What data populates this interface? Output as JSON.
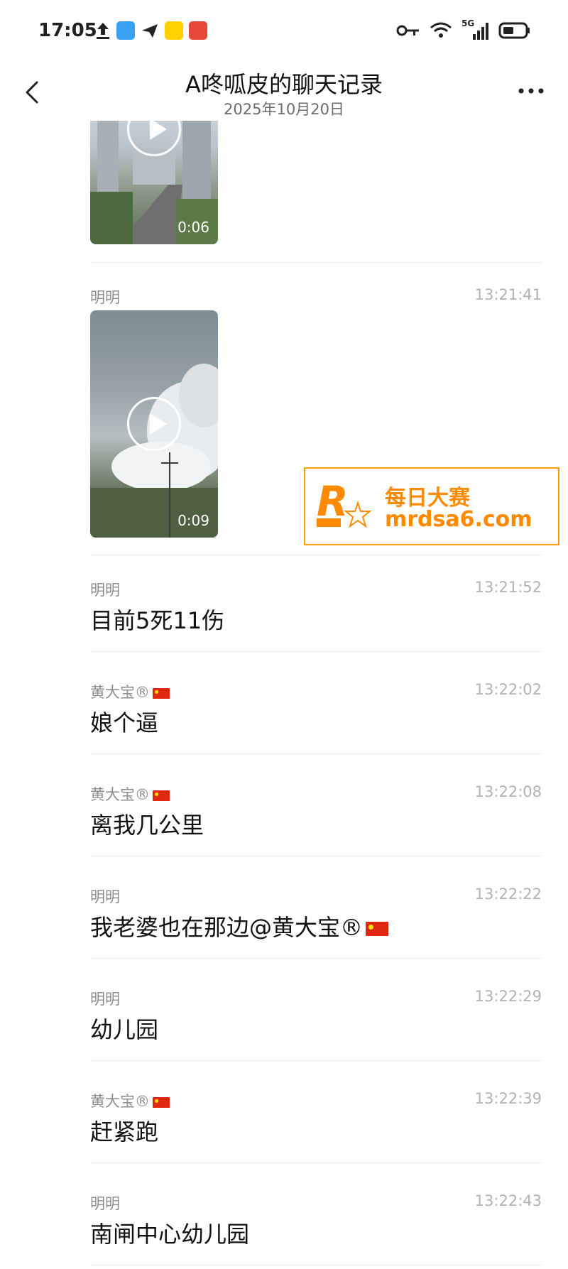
{
  "status_bar": {
    "time": "17:05",
    "network": "5G",
    "icons": [
      "upload-icon",
      "book-app-icon",
      "telegram-icon",
      "meituan-app-icon",
      "news-app-icon",
      "vpn-key-icon",
      "wifi-icon",
      "signal-icon",
      "battery-icon"
    ]
  },
  "header": {
    "title": "A咚呱皮的聊天记录",
    "date": "2025年10月20日"
  },
  "messages": [
    {
      "type": "video",
      "duration": "0:06"
    },
    {
      "type": "video",
      "sender": "明明",
      "time": "13:21:41",
      "duration": "0:09"
    },
    {
      "type": "text",
      "sender": "明明",
      "time": "13:21:52",
      "text": "目前5死11伤"
    },
    {
      "type": "text",
      "sender": "黄大宝®",
      "time": "13:22:02",
      "text": "娘个逼"
    },
    {
      "type": "text",
      "sender": "黄大宝®",
      "time": "13:22:08",
      "text": "离我几公里"
    },
    {
      "type": "text",
      "sender": "明明",
      "time": "13:22:22",
      "text": "我老婆也在那边@黄大宝®"
    },
    {
      "type": "text",
      "sender": "明明",
      "time": "13:22:29",
      "text": "幼儿园"
    },
    {
      "type": "text",
      "sender": "黄大宝®",
      "time": "13:22:39",
      "text": "赶紧跑"
    },
    {
      "type": "text",
      "sender": "明明",
      "time": "13:22:43",
      "text": "南闸中心幼儿园"
    }
  ],
  "watermark": {
    "line1": "每日大赛",
    "line2": "mrdsa6.com",
    "logo_text": "每日大赛",
    "color": "#ff8a00"
  }
}
